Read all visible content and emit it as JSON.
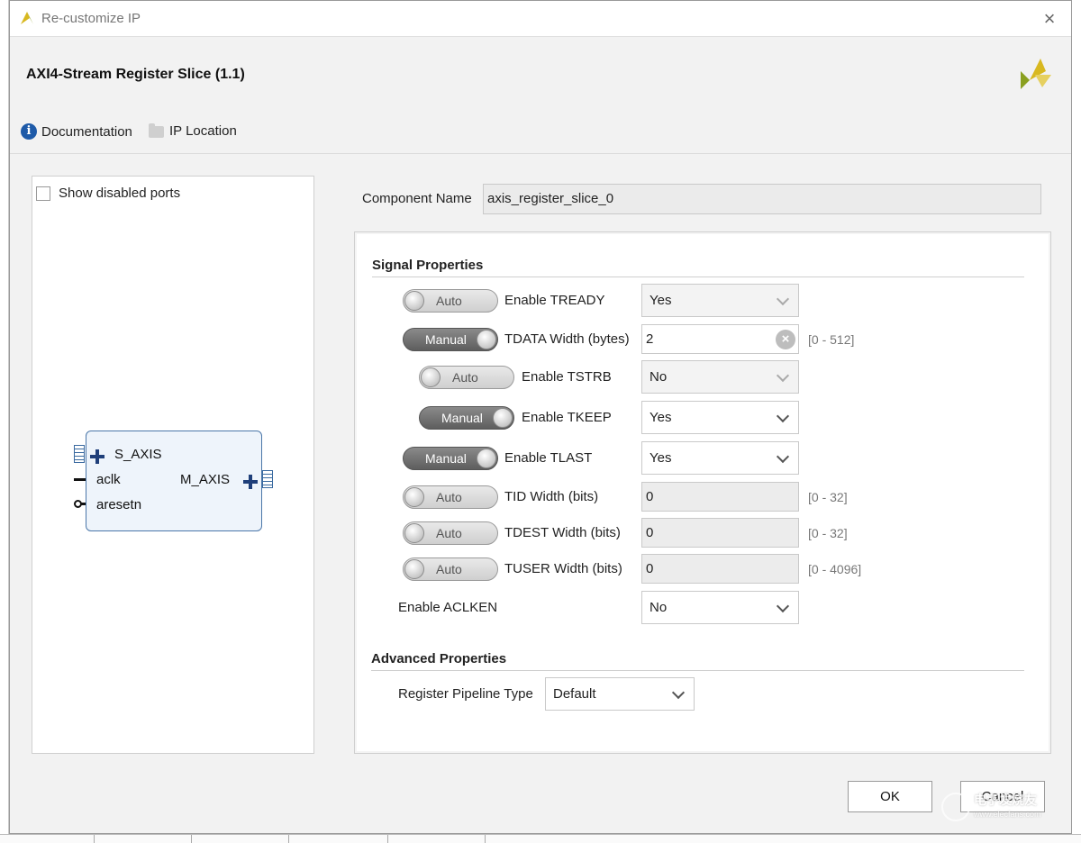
{
  "window": {
    "title": "Re-customize IP",
    "close_glyph": "×"
  },
  "header": {
    "title": "AXI4-Stream Register Slice (1.1)",
    "documentation_label": "Documentation",
    "ip_location_label": "IP Location"
  },
  "symbol": {
    "show_disabled_ports_label": "Show disabled ports",
    "ports": {
      "s_axis": "S_AXIS",
      "aclk": "aclk",
      "aresetn": "aresetn",
      "m_axis": "M_AXIS"
    }
  },
  "component": {
    "label": "Component Name",
    "value": "axis_register_slice_0"
  },
  "signal_properties": {
    "title": "Signal Properties",
    "enable_tready": {
      "mode": "Auto",
      "label": "Enable TREADY",
      "value": "Yes"
    },
    "tdata_width": {
      "mode": "Manual",
      "label": "TDATA Width (bytes)",
      "value": "2",
      "range": "[0 - 512]"
    },
    "enable_tstrb": {
      "mode": "Auto",
      "label": "Enable TSTRB",
      "value": "No"
    },
    "enable_tkeep": {
      "mode": "Manual",
      "label": "Enable TKEEP",
      "value": "Yes"
    },
    "enable_tlast": {
      "mode": "Manual",
      "label": "Enable TLAST",
      "value": "Yes"
    },
    "tid_width": {
      "mode": "Auto",
      "label": "TID Width (bits)",
      "value": "0",
      "range": "[0 - 32]"
    },
    "tdest_width": {
      "mode": "Auto",
      "label": "TDEST Width (bits)",
      "value": "0",
      "range": "[0 - 32]"
    },
    "tuser_width": {
      "mode": "Auto",
      "label": "TUSER Width (bits)",
      "value": "0",
      "range": "[0 - 4096]"
    },
    "enable_aclken": {
      "label": "Enable ACLKEN",
      "value": "No"
    }
  },
  "advanced_properties": {
    "title": "Advanced Properties",
    "register_pipeline_type": {
      "label": "Register Pipeline Type",
      "value": "Default"
    }
  },
  "buttons": {
    "ok": "OK",
    "cancel": "Cancel"
  },
  "watermark": {
    "line1": "电子发烧友",
    "line2": "www.elecfans.com"
  },
  "colors": {
    "accent_blue": "#1e5aa8",
    "ip_block_border": "#4b77a9",
    "brand_yellow": "#e0c020",
    "brand_green": "#8aa020"
  }
}
